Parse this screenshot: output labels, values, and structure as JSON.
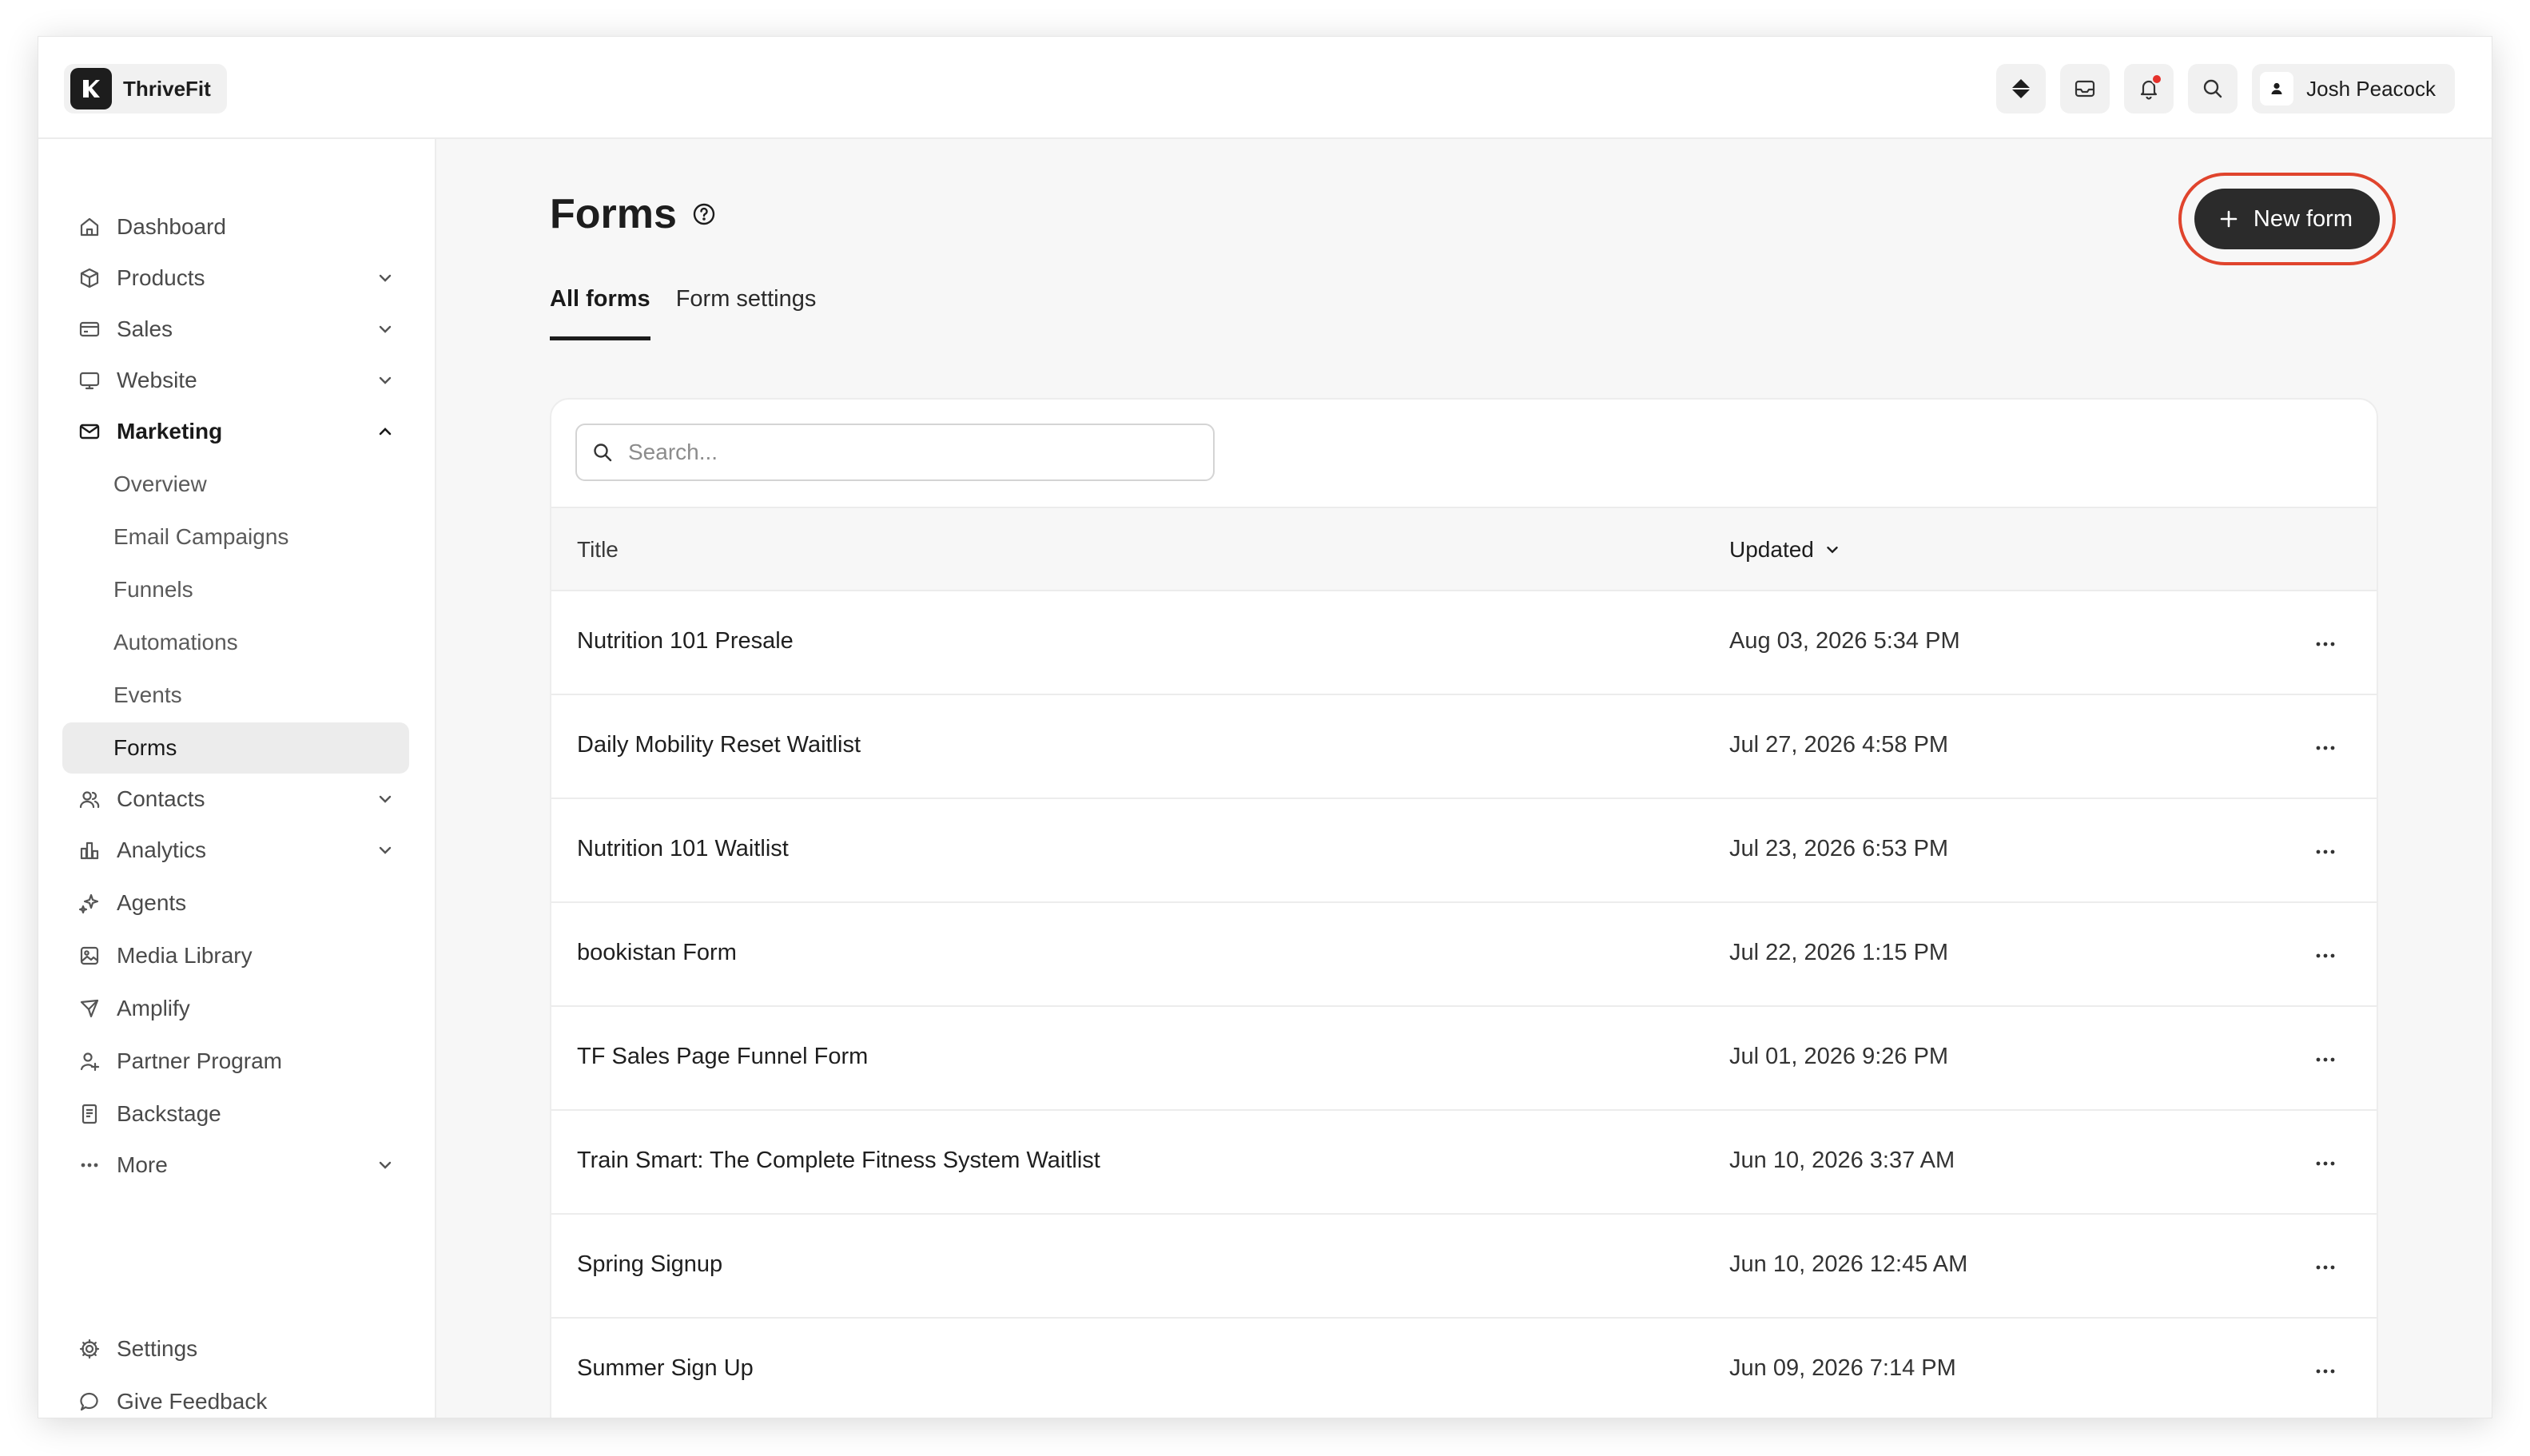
{
  "brand": {
    "name": "ThriveFit"
  },
  "user": {
    "name": "Josh Peacock"
  },
  "sidebar": {
    "items": [
      {
        "label": "Dashboard",
        "icon": "home-icon"
      },
      {
        "label": "Products",
        "icon": "box-icon"
      },
      {
        "label": "Sales",
        "icon": "credit-card-icon"
      },
      {
        "label": "Website",
        "icon": "monitor-icon"
      },
      {
        "label": "Marketing",
        "icon": "mail-icon"
      },
      {
        "label": "Overview"
      },
      {
        "label": "Email Campaigns"
      },
      {
        "label": "Funnels"
      },
      {
        "label": "Automations"
      },
      {
        "label": "Events"
      },
      {
        "label": "Forms"
      },
      {
        "label": "Contacts",
        "icon": "users-icon"
      },
      {
        "label": "Analytics",
        "icon": "bar-chart-icon"
      },
      {
        "label": "Agents",
        "icon": "sparkle-icon"
      },
      {
        "label": "Media Library",
        "icon": "image-icon"
      },
      {
        "label": "Amplify",
        "icon": "send-icon"
      },
      {
        "label": "Partner Program",
        "icon": "user-plus-icon"
      },
      {
        "label": "Backstage",
        "icon": "book-icon"
      },
      {
        "label": "More",
        "icon": "ellipsis-icon"
      }
    ],
    "footer": [
      {
        "label": "Settings",
        "icon": "gear-icon"
      },
      {
        "label": "Give Feedback",
        "icon": "chat-bubble-icon"
      }
    ]
  },
  "page": {
    "title": "Forms",
    "new_form_label": "New form",
    "tabs": [
      "All forms",
      "Form settings"
    ]
  },
  "search": {
    "placeholder": "Search..."
  },
  "table": {
    "columns": [
      "Title",
      "Updated"
    ],
    "rows": [
      {
        "title": "Nutrition 101 Presale",
        "updated": "Aug 03, 2026 5:34 PM"
      },
      {
        "title": "Daily Mobility Reset Waitlist",
        "updated": "Jul 27, 2026 4:58 PM"
      },
      {
        "title": "Nutrition 101 Waitlist",
        "updated": "Jul 23, 2026 6:53 PM"
      },
      {
        "title": "bookistan Form",
        "updated": "Jul 22, 2026 1:15 PM"
      },
      {
        "title": "TF Sales Page Funnel Form",
        "updated": "Jul 01, 2026 9:26 PM"
      },
      {
        "title": "Train Smart: The Complete Fitness System Waitlist",
        "updated": "Jun 10, 2026 3:37 AM"
      },
      {
        "title": "Spring Signup",
        "updated": "Jun 10, 2026 12:45 AM"
      },
      {
        "title": "Summer Sign Up",
        "updated": "Jun 09, 2026 7:14 PM"
      }
    ]
  },
  "colors": {
    "accent": "#2b2b2b",
    "highlight": "#e0442d",
    "notification": "#e5312b"
  }
}
